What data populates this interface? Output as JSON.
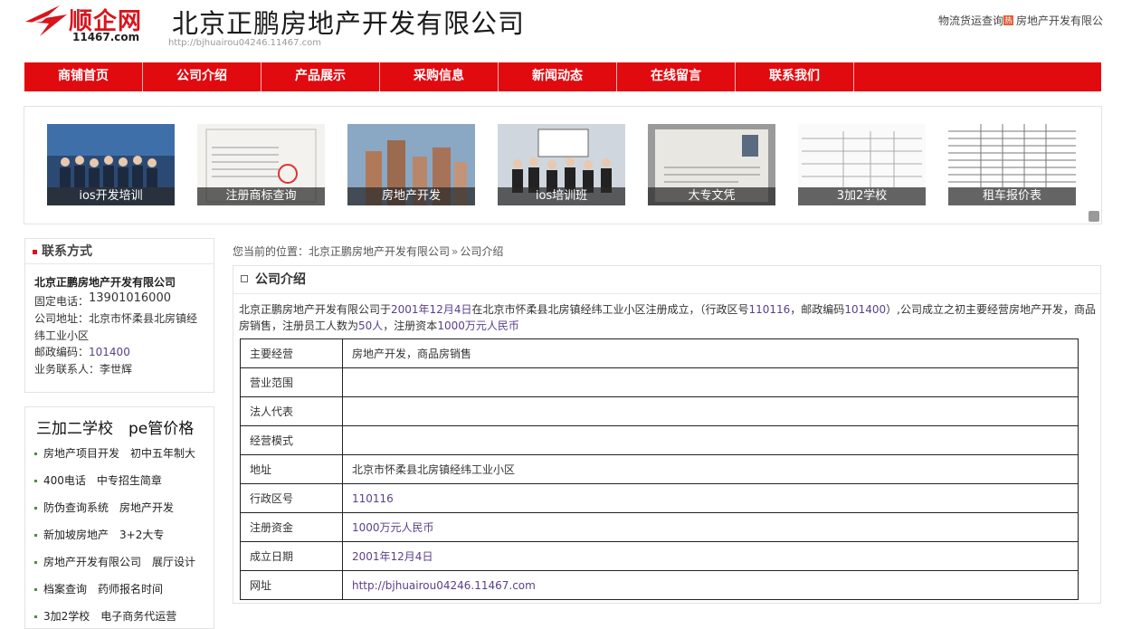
{
  "header": {
    "logo_text": "顺企网",
    "logo_sub": "11467.com",
    "company_title": "北京正鹏房地产开发有限公司",
    "site_url": "http://bjhuairou04246.11467.com",
    "top_link_1": "物流货运查询",
    "hot_badge": "热",
    "top_link_2": "房地产开发有限公"
  },
  "nav": {
    "items": [
      "商铺首页",
      "公司介绍",
      "产品展示",
      "采购信息",
      "新闻动态",
      "在线留言",
      "联系我们"
    ]
  },
  "gallery": {
    "captions": [
      "ios开发培训",
      "注册商标查询",
      "房地产开发",
      "ios培训班",
      "大专文凭",
      "3加2学校",
      "租车报价表"
    ],
    "image_icons": [
      "group-photo-icon",
      "business-license-icon",
      "buildings-icon",
      "classroom-photo-icon",
      "diploma-icon",
      "document-table-icon",
      "price-table-icon"
    ]
  },
  "contact": {
    "heading": "联系方式",
    "company": "北京正鹏房地产开发有限公司",
    "phone_label": "固定电话：",
    "phone": "13901016000",
    "address_label": "公司地址：",
    "address": "北京市怀柔县北房镇经纬工业小区",
    "postcode_label": "邮政编码：",
    "postcode": "101400",
    "contact_label": "业务联系人：",
    "contact_person": "李世辉"
  },
  "links": {
    "title": "三加二学校　pe管价格",
    "rows": [
      [
        "房地产项目开发",
        "初中五年制大"
      ],
      [
        "400电话",
        "中专招生简章"
      ],
      [
        "防伪查询系统",
        "房地产开发"
      ],
      [
        "新加坡房地产",
        "3+2大专"
      ],
      [
        "房地产开发有限公司",
        "展厅设计"
      ],
      [
        "档案查询",
        "药师报名时间"
      ],
      [
        "3加2学校",
        "电子商务代运营"
      ]
    ]
  },
  "breadcrumb": {
    "prefix": "您当前的位置：",
    "company": "北京正鹏房地产开发有限公司",
    "sep": "»",
    "current": "公司介绍"
  },
  "main": {
    "heading": "公司介绍",
    "intro_1": "北京正鹏房地产开发有限公司于",
    "intro_date": "2001年12月4日",
    "intro_2": "在北京市怀柔县北房镇经纬工业小区注册成立，（行政区号",
    "intro_code": "110116",
    "intro_3": "，邮政编码",
    "intro_post": "101400",
    "intro_4": "）,公司成立之初主要经营房地产开发，商品房销售，注册员工人数为",
    "intro_staff": "50人",
    "intro_5": "，注册资本",
    "intro_capital": "1000万元人民币",
    "table": [
      {
        "k": "主要经营",
        "v": "房地产开发，商品房销售",
        "blue": false
      },
      {
        "k": "营业范围",
        "v": "",
        "blue": false
      },
      {
        "k": "法人代表",
        "v": "",
        "blue": false
      },
      {
        "k": "经营模式",
        "v": "",
        "blue": false
      },
      {
        "k": "地址",
        "v": "北京市怀柔县北房镇经纬工业小区",
        "blue": false
      },
      {
        "k": "行政区号",
        "v": "110116",
        "blue": true
      },
      {
        "k": "注册资金",
        "v": "1000万元人民币",
        "blue": true
      },
      {
        "k": "成立日期",
        "v": "2001年12月4日",
        "blue": true
      },
      {
        "k": "网址",
        "v": "http://bjhuairou04246.11467.com",
        "blue": true
      }
    ]
  },
  "colors": {
    "brand_red": "#e10a0f",
    "link_purple": "#5b3f8a"
  }
}
